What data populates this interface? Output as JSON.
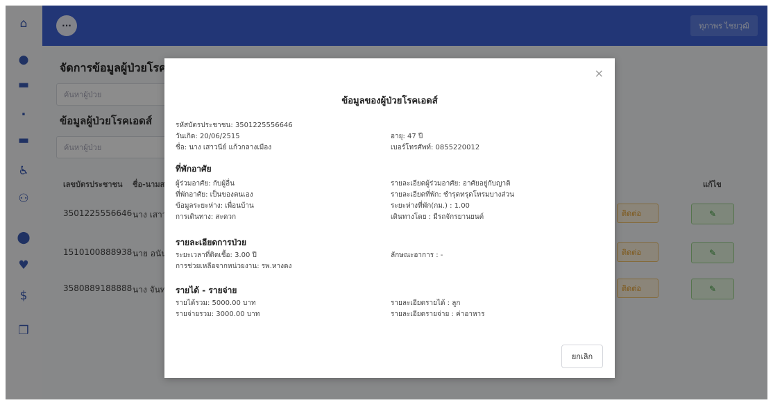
{
  "topbar": {
    "menu_label": "···",
    "user_name": "ทุภาพร ไชยวุฒิ"
  },
  "sidebar": {
    "icons": [
      "home-icon",
      "user-icon",
      "bed-icon",
      "person-small-icon",
      "bed-icon-2",
      "wheelchair-icon",
      "family-icon",
      "location-icon",
      "heart-icon",
      "dollar-icon",
      "copy-icon"
    ],
    "glyphs": [
      "⌂",
      "●",
      "▬",
      "⬝",
      "▬",
      "♿",
      "⚇",
      "⬤",
      "♥",
      "$",
      "❐"
    ]
  },
  "page": {
    "title": "จัดการข้อมูลผู้ป่วยโรคเอดส์",
    "search_placeholder": "ค้นหาผู้ป่วย",
    "sub_title": "ข้อมูลผู้ป่วยโรคเอดส์",
    "search2_placeholder": "ค้นหาผู้ป่วย",
    "columns": {
      "id": "เลขบัตรประชาชน",
      "name": "ชื่อ-นามสกุล",
      "edit": "แก้ไข"
    },
    "rows": [
      {
        "id": "3501225556646",
        "name": "นาง เสาวนีย์ แก้วกลางเมือง",
        "contact": "ติดต่อ",
        "edit": "✎"
      },
      {
        "id": "1510100888938",
        "name": "นาย อนันต์",
        "contact": "ติดต่อ",
        "edit": "✎"
      },
      {
        "id": "3580889188888",
        "name": "นาง จันทร์",
        "contact": "ติดต่อ",
        "edit": "✎"
      }
    ]
  },
  "modal": {
    "close": "×",
    "title": "ข้อมูลของผู้ป่วยโรคเอดส์",
    "id_card": "รหัสบัตรประชาชน: 3501225556646",
    "birth": "วันเกิด: 20/06/2515",
    "name": "ชื่อ: นาง เสาวนีย์ แก้วกลางเมือง",
    "age": "อายุ: 47 ปี",
    "phone": "เบอร์โทรศัพท์: 0855220012",
    "housing": {
      "title": "ที่พักอาศัย",
      "cohabit": "ผู้ร่วมอาศัย: กับผู้อื่น",
      "cohabit_detail": "รายละเอียดผู้ร่วมอาศัย: อาศัยอยู่กับญาติ",
      "residence": "ที่พักอาศัย: เป็นของตนเอง",
      "residence_detail": "รายละเอียดที่พัก: ชำรุดทรุดโทรมบางส่วน",
      "distance_info": "ข้อมูลระยะห่าง: เพื่อนบ้าน",
      "distance_km": "ระยะห่างที่พัก(กม.) : 1.00",
      "travel": "การเดินทาง: สะดวก",
      "travel_by": "เดินทางโดย : มีรถจักรยานยนต์"
    },
    "illness": {
      "title": "รายละเอียดการป่วย",
      "duration": "ระยะเวลาที่ติดเชื้อ: 3.00 ปี",
      "symptoms": "ลักษณะอาการ : -",
      "help": "การช่วยเหลือจากหน่วยงาน: รพ.หางดง"
    },
    "finance": {
      "title": "รายได้ - รายจ่าย",
      "income": "รายได้รวม: 5000.00 บาท",
      "income_detail": "รายละเอียดรายได้ : ลูก",
      "expense": "รายจ่ายรวม: 3000.00 บาท",
      "expense_detail": "รายละเอียดรายจ่าย : ค่าอาหาร"
    },
    "cancel": "ยกเลิก"
  },
  "colors": {
    "topbar": "#3f63d8",
    "overlay": "rgba(0,0,0,0.45)",
    "accent_icon": "#3b5bb5"
  }
}
